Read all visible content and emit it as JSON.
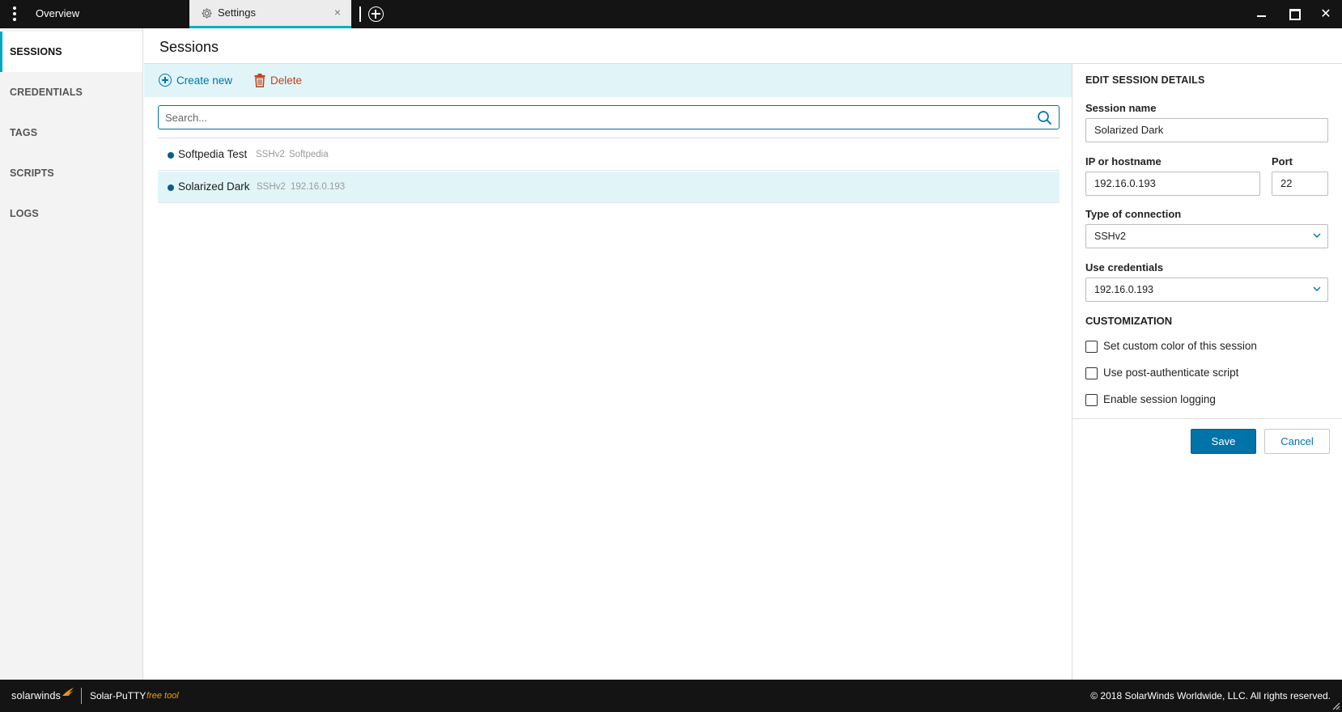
{
  "titlebar": {
    "tab_overview": "Overview",
    "tab_settings": "Settings",
    "close_glyph": "×",
    "window_close_glyph": "✕"
  },
  "sidebar": {
    "items": [
      {
        "label": "SESSIONS",
        "active": true
      },
      {
        "label": "CREDENTIALS",
        "active": false
      },
      {
        "label": "TAGS",
        "active": false
      },
      {
        "label": "SCRIPTS",
        "active": false
      },
      {
        "label": "LOGS",
        "active": false
      }
    ]
  },
  "header": {
    "title": "Sessions"
  },
  "toolbar": {
    "create_label": "Create new",
    "delete_label": "Delete"
  },
  "search": {
    "placeholder": "Search..."
  },
  "sessions": [
    {
      "name": "Softpedia Test",
      "type": "SSHv2",
      "host": "Softpedia",
      "selected": false
    },
    {
      "name": "Solarized Dark",
      "type": "SSHv2",
      "host": "192.16.0.193",
      "selected": true
    }
  ],
  "edit_panel": {
    "heading": "EDIT SESSION DETAILS",
    "session_name_label": "Session name",
    "session_name_value": "Solarized Dark",
    "host_label": "IP or hostname",
    "host_value": "192.16.0.193",
    "port_label": "Port",
    "port_value": "22",
    "connection_label": "Type of connection",
    "connection_value": "SSHv2",
    "credentials_label": "Use credentials",
    "credentials_value": "192.16.0.193",
    "customization_heading": "CUSTOMIZATION",
    "checkboxes": [
      {
        "label": "Set custom color of this session",
        "checked": false
      },
      {
        "label": "Use post-authenticate script",
        "checked": false
      },
      {
        "label": "Enable session logging",
        "checked": false
      }
    ],
    "save_label": "Save",
    "cancel_label": "Cancel"
  },
  "footer": {
    "brand": "solarwinds",
    "product": "Solar-PuTTY",
    "product_tag": "free tool",
    "copyright": "© 2018 SolarWinds Worldwide, LLC. All rights reserved."
  },
  "colors": {
    "accent": "#0073a8",
    "tab_indicator": "#00b0c8",
    "selected_row": "#e1f5f8",
    "delete": "#c24119",
    "titlebar": "#141414",
    "brand_tag": "#f39c12"
  }
}
